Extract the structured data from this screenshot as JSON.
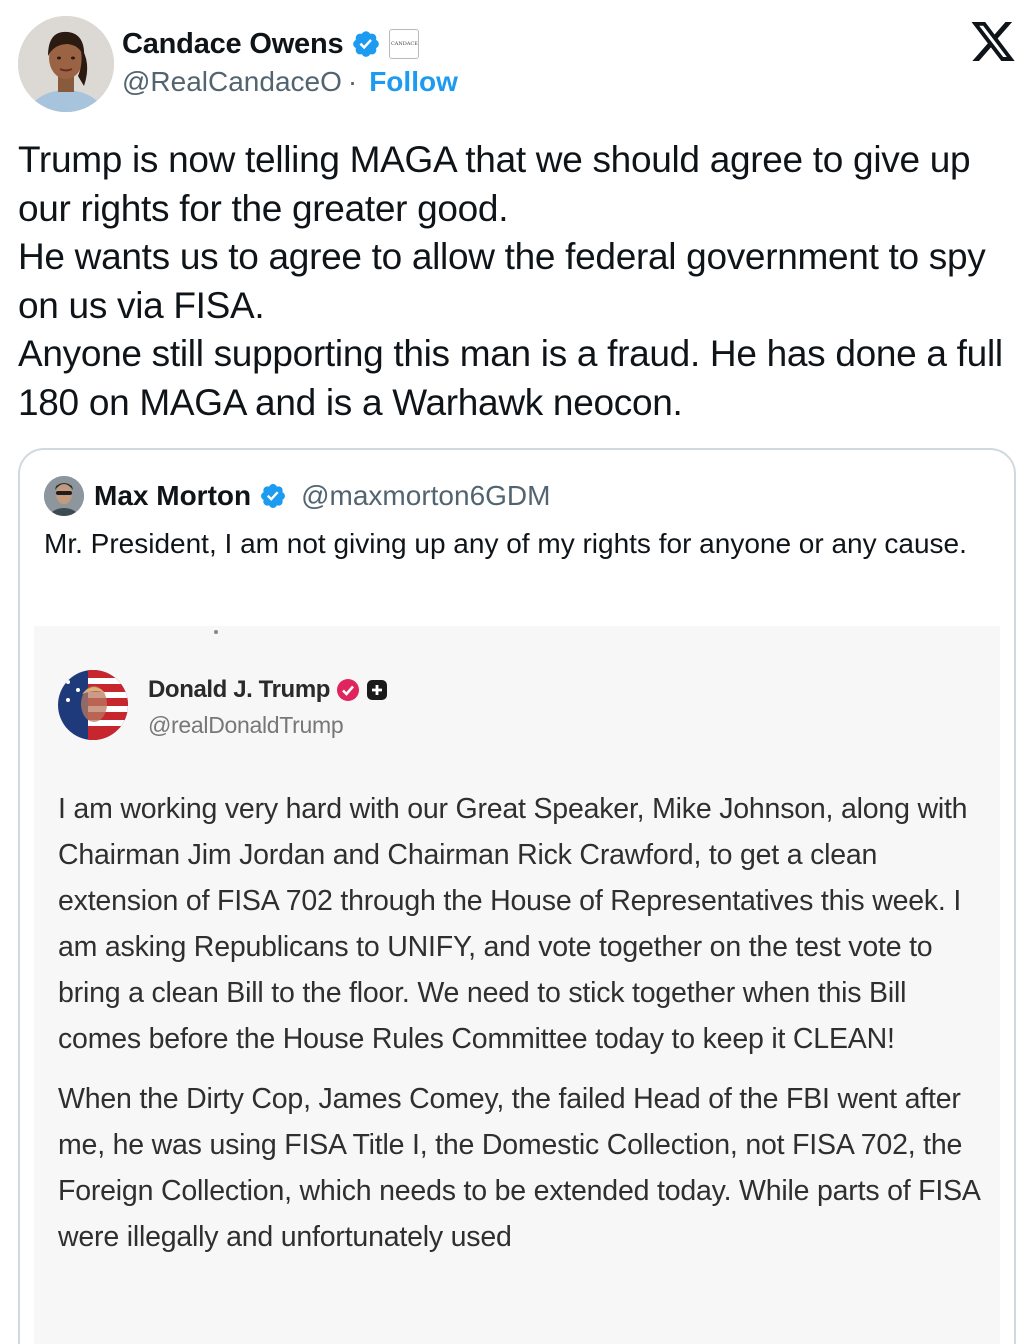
{
  "tweet": {
    "author": {
      "name": "Candace Owens",
      "handle": "@RealCandaceO",
      "follow_label": "Follow",
      "separator": "·",
      "affiliate_badge_text": "CANDACE"
    },
    "text_lines": [
      "Trump is now telling MAGA that we should agree to give up our rights for the greater good.",
      "He wants us to agree to allow the federal government to spy on us via FISA.",
      "Anyone still supporting this man is a fraud. He has done a full 180 on MAGA and is a Warhawk neocon."
    ]
  },
  "quoted_tweet": {
    "author": {
      "name": "Max Morton",
      "handle": "@maxmorton6GDM"
    },
    "text": "Mr. President, I am not giving up any of my rights for anyone or any cause.",
    "image": {
      "author_name": "Donald J. Trump",
      "author_handle": "@realDonaldTrump",
      "paragraphs": [
        "I am working very hard with our Great Speaker, Mike Johnson, along with Chairman Jim Jordan and Chairman Rick Crawford, to get a clean extension of FISA 702 through the House of Representatives this week. I am asking Republicans to UNIFY, and vote together on the test vote to bring a clean Bill to the floor. We need to stick together when this Bill comes before the House Rules Committee today to keep it CLEAN!",
        "When the Dirty Cop, James Comey, the failed Head of the FBI went after me, he was using FISA Title I, the Domestic Collection, not FISA 702, the Foreign Collection, which needs to be extended today. While parts of FISA were illegally and unfortunately used"
      ]
    }
  },
  "icons": {
    "verified": "verified-badge-icon",
    "x_logo": "x-logo-icon",
    "truth_verified": "truth-verified-icon",
    "truth_plus": "plus-icon"
  },
  "colors": {
    "link": "#1d9bf0",
    "text": "#0f1419",
    "secondary": "#536471",
    "border": "#cfd9de",
    "truth_badge": "#e0245e"
  }
}
